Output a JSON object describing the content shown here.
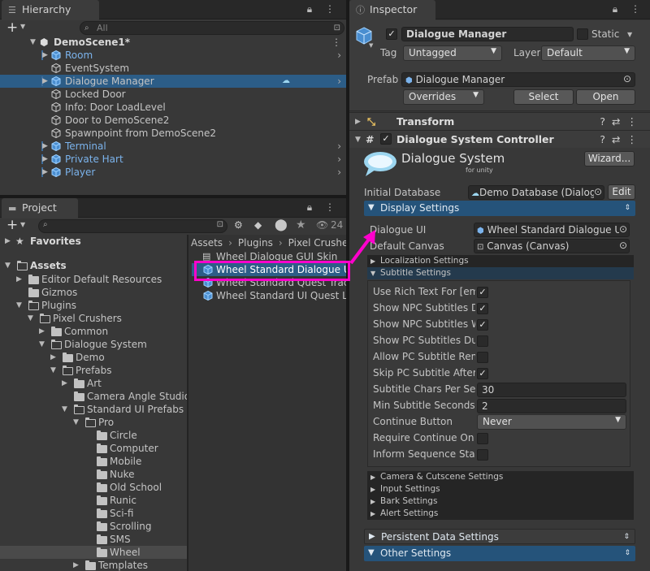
{
  "hierarchy": {
    "tab_title": "Hierarchy",
    "add_label": "+",
    "search_placeholder": "All",
    "scene": "DemoScene1*",
    "items": [
      {
        "label": "Room",
        "prefab": true
      },
      {
        "label": "EventSystem",
        "prefab": false
      },
      {
        "label": "Dialogue Manager",
        "prefab": true
      },
      {
        "label": "Locked Door",
        "prefab": false
      },
      {
        "label": "Info: Door LoadLevel",
        "prefab": false
      },
      {
        "label": "Door to DemoScene2",
        "prefab": false
      },
      {
        "label": "Spawnpoint from DemoScene2",
        "prefab": false
      },
      {
        "label": "Terminal",
        "prefab": true
      },
      {
        "label": "Private Hart",
        "prefab": true
      },
      {
        "label": "Player",
        "prefab": true
      }
    ]
  },
  "project": {
    "tab_title": "Project",
    "add_label": "+",
    "hidden_count": "24",
    "favorites": "Favorites",
    "tree": [
      "Assets",
      "Editor Default Resources",
      "Gizmos",
      "Plugins",
      "Pixel Crushers",
      "Common",
      "Dialogue System",
      "Demo",
      "Prefabs",
      "Art",
      "Camera Angle Studio",
      "Standard UI Prefabs",
      "Pro",
      "Circle",
      "Computer",
      "Mobile",
      "Nuke",
      "Old School",
      "Runic",
      "Sci-fi",
      "Scrolling",
      "SMS",
      "Wheel",
      "Templates"
    ],
    "breadcrumb": [
      "Assets",
      "Plugins",
      "Pixel Crushers"
    ],
    "files": [
      "Wheel Dialogue GUI Skin",
      "Wheel Standard Dialogue UI",
      "Wheel Standard Quest Track",
      "Wheel Standard UI Quest Lo"
    ]
  },
  "inspector": {
    "tab_title": "Inspector",
    "object_name": "Dialogue Manager",
    "static_label": "Static",
    "tag_label": "Tag",
    "tag_value": "Untagged",
    "layer_label": "Layer",
    "layer_value": "Default",
    "prefab_label": "Prefab",
    "prefab_value": "Dialogue Manager",
    "overrides_label": "Overrides",
    "select_label": "Select",
    "open_label": "Open",
    "transform_label": "Transform",
    "controller_label": "Dialogue System Controller",
    "logo_title": "Dialogue System",
    "logo_sub": "for unity",
    "wizard_label": "Wizard...",
    "initial_db_label": "Initial Database",
    "initial_db_value": "Demo Database (Dialog",
    "edit_label": "Edit",
    "display_settings": "Display Settings",
    "dialogue_ui_label": "Dialogue UI",
    "dialogue_ui_value": "Wheel Standard Dialogue UI",
    "default_canvas_label": "Default Canvas",
    "default_canvas_value": "Canvas (Canvas)",
    "localization_settings": "Localization Settings",
    "subtitle_settings": "Subtitle Settings",
    "subtitle_rows": [
      {
        "label": "Use Rich Text For [em",
        "type": "check",
        "value": "✓"
      },
      {
        "label": "Show NPC Subtitles D",
        "type": "check",
        "value": "✓"
      },
      {
        "label": "Show NPC Subtitles W",
        "type": "check",
        "value": "✓"
      },
      {
        "label": "Show PC Subtitles Dur",
        "type": "check",
        "value": ""
      },
      {
        "label": "Allow PC Subtitle Rem",
        "type": "check",
        "value": ""
      },
      {
        "label": "Skip PC Subtitle After",
        "type": "check",
        "value": "✓"
      },
      {
        "label": "Subtitle Chars Per Sec",
        "type": "text",
        "value": "30"
      },
      {
        "label": "Min Subtitle Seconds",
        "type": "text",
        "value": "2"
      },
      {
        "label": "Continue Button",
        "type": "drop",
        "value": "Never"
      },
      {
        "label": "Require Continue On L",
        "type": "check",
        "value": ""
      },
      {
        "label": "Inform Sequence Start",
        "type": "check",
        "value": ""
      }
    ],
    "collapsed_sections": [
      "Camera & Cutscene Settings",
      "Input Settings",
      "Bark Settings",
      "Alert Settings"
    ],
    "persistent_data": "Persistent Data Settings",
    "other_settings": "Other Settings"
  },
  "colors": {
    "selection": "#2c5d87",
    "section_blue": "#25537a",
    "highlight": "#ff00cc",
    "prefab_blue": "#7bb3ec"
  }
}
